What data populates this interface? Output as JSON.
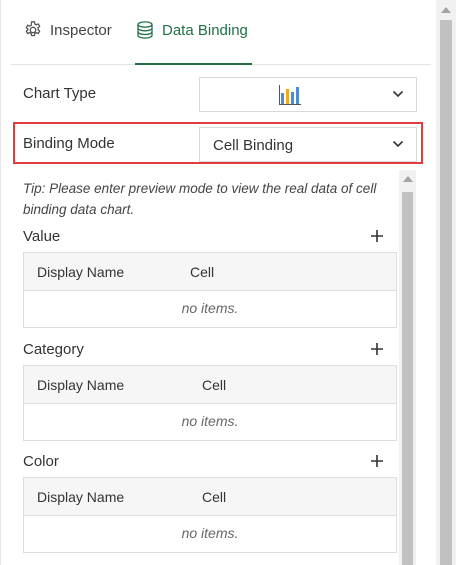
{
  "tabs": [
    {
      "label": "Inspector",
      "icon": "gear-icon",
      "active": false
    },
    {
      "label": "Data Binding",
      "icon": "database-icon",
      "active": true
    }
  ],
  "colors": {
    "accent": "#1e7145",
    "highlight": "#e23d3d",
    "chart_icon_blue": "#4a8fd4",
    "chart_icon_orange": "#f5a623"
  },
  "chart_type": {
    "label": "Chart Type",
    "selected_icon": "bar-chart-icon"
  },
  "binding_mode": {
    "label": "Binding Mode",
    "value": "Cell Binding"
  },
  "tip": "Tip: Please enter preview mode to view the real data of cell binding data chart.",
  "sections": [
    {
      "title": "Value",
      "columns": [
        "Display Name",
        "Cell"
      ],
      "empty_text": "no items."
    },
    {
      "title": "Category",
      "columns": [
        "Display Name",
        "Cell"
      ],
      "empty_text": "no items."
    },
    {
      "title": "Color",
      "columns": [
        "Display Name",
        "Cell"
      ],
      "empty_text": "no items."
    }
  ]
}
